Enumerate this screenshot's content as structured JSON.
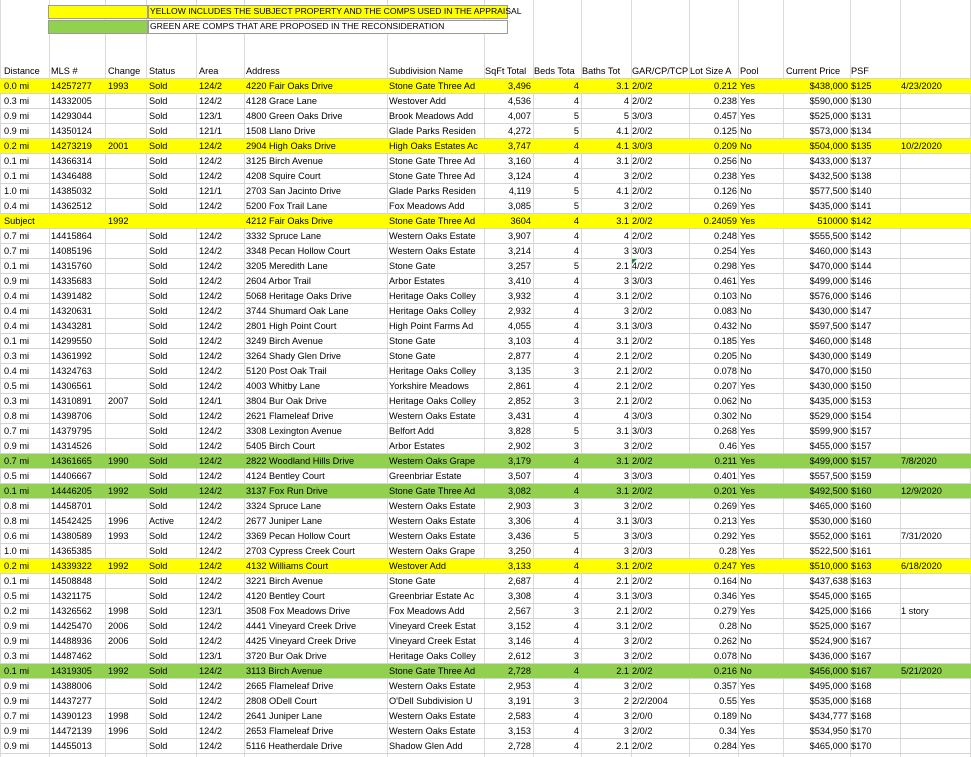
{
  "legend": {
    "yellow_text": "YELLOW INCLUDES THE SUBJECT PROPERTY AND THE COMPS USED IN THE APPRAISAL",
    "green_text": "GREEN ARE COMPS THAT ARE PROPOSED IN THE RECONSIDERATION",
    "yellow_color": "#ffff00",
    "green_color": "#92d050"
  },
  "headers": [
    "Distance",
    "MLS #",
    "Change",
    "Status",
    "Area",
    "Address",
    "Subdivision Name",
    "SqFt Total",
    "Beds Tota",
    "Baths Tot",
    "GAR/CP/TCP",
    "Lot Size A",
    "Pool",
    "Current Price",
    "PSF",
    ""
  ],
  "rows": [
    {
      "hl": "yellow",
      "c": [
        "0.0 mi",
        "14257277",
        "1993",
        "Sold",
        "124/2",
        "4220 Fair Oaks Drive",
        "Stone Gate Three Ad",
        "3,496",
        "4",
        "3.1",
        "2/0/2",
        "0.212",
        "Yes",
        "$438,000",
        "$125",
        "4/23/2020"
      ]
    },
    {
      "hl": "",
      "c": [
        "0.3 mi",
        "14332005",
        "",
        "Sold",
        "124/2",
        "4128 Grace Lane",
        "Westover Add",
        "4,536",
        "4",
        "4",
        "2/0/2",
        "0.238",
        "Yes",
        "$590,000",
        "$130",
        ""
      ]
    },
    {
      "hl": "",
      "c": [
        "0.9 mi",
        "14293044",
        "",
        "Sold",
        "123/1",
        "4800 Green Oaks Drive",
        "Brook Meadows Add",
        "4,007",
        "5",
        "5",
        "3/0/3",
        "0.457",
        "Yes",
        "$525,000",
        "$131",
        ""
      ]
    },
    {
      "hl": "",
      "c": [
        "0.9 mi",
        "14350124",
        "",
        "Sold",
        "121/1",
        "1508 Llano Drive",
        "Glade Parks Residen",
        "4,272",
        "5",
        "4.1",
        "2/0/2",
        "0.125",
        "No",
        "$573,000",
        "$134",
        ""
      ]
    },
    {
      "hl": "yellow",
      "c": [
        "0.2 mi",
        "14273219",
        "2001",
        "Sold",
        "124/2",
        "2904 High Oaks Drive",
        "High Oaks Estates Ac",
        "3,747",
        "4",
        "4.1",
        "3/0/3",
        "0.209",
        "No",
        "$504,000",
        "$135",
        "10/2/2020"
      ]
    },
    {
      "hl": "",
      "c": [
        "0.1 mi",
        "14366314",
        "",
        "Sold",
        "124/2",
        "3125 Birch Avenue",
        "Stone Gate Three Ad",
        "3,160",
        "4",
        "3.1",
        "2/0/2",
        "0.256",
        "No",
        "$433,000",
        "$137",
        ""
      ]
    },
    {
      "hl": "",
      "c": [
        "0.1 mi",
        "14346488",
        "",
        "Sold",
        "124/2",
        "4208 Squire Court",
        "Stone Gate Three Ad",
        "3,124",
        "4",
        "3",
        "2/0/2",
        "0.238",
        "Yes",
        "$432,500",
        "$138",
        ""
      ]
    },
    {
      "hl": "",
      "c": [
        "1.0 mi",
        "14385032",
        "",
        "Sold",
        "121/1",
        "2703 San Jacinto Drive",
        "Glade Parks Residen",
        "4,119",
        "5",
        "4.1",
        "2/0/2",
        "0.126",
        "No",
        "$577,500",
        "$140",
        ""
      ]
    },
    {
      "hl": "",
      "c": [
        "0.4 mi",
        "14362512",
        "",
        "Sold",
        "124/2",
        "5200 Fox Trail Lane",
        "Fox Meadows Add",
        "3,085",
        "5",
        "3",
        "2/0/2",
        "0.269",
        "Yes",
        "$435,000",
        "$141",
        ""
      ]
    },
    {
      "hl": "yellow",
      "c": [
        "Subject",
        "",
        "1992",
        "",
        "",
        "4212 Fair Oaks Drive",
        "Stone Gate Three Ad",
        "3604",
        "4",
        "3.1",
        "2/0/2",
        "0.24059",
        "Yes",
        "510000",
        "$142",
        ""
      ]
    },
    {
      "hl": "",
      "c": [
        "0.7 mi",
        "14415864",
        "",
        "Sold",
        "124/2",
        "3332 Spruce Lane",
        "Western Oaks Estate",
        "3,907",
        "4",
        "4",
        "2/0/2",
        "0.248",
        "Yes",
        "$555,500",
        "$142",
        ""
      ]
    },
    {
      "hl": "",
      "c": [
        "0.7 mi",
        "14085196",
        "",
        "Sold",
        "124/2",
        "3348 Pecan Hollow Court",
        "Western Oaks Estate",
        "3,214",
        "4",
        "3",
        "3/0/3",
        "0.254",
        "Yes",
        "$460,000",
        "$143",
        ""
      ]
    },
    {
      "hl": "",
      "c": [
        "0.1 mi",
        "14315760",
        "",
        "Sold",
        "124/2",
        "3205 Meredith Lane",
        "Stone Gate",
        "3,257",
        "5",
        "2.1",
        "4/2/2",
        "0.298",
        "Yes",
        "$470,000",
        "$144",
        ""
      ]
    },
    {
      "hl": "",
      "c": [
        "0.9 mi",
        "14335683",
        "",
        "Sold",
        "124/2",
        "2604 Arbor Trail",
        "Arbor Estates",
        "3,410",
        "4",
        "3",
        "3/0/3",
        "0.461",
        "Yes",
        "$499,000",
        "$146",
        ""
      ]
    },
    {
      "hl": "",
      "c": [
        "0.4 mi",
        "14391482",
        "",
        "Sold",
        "124/2",
        "5068 Heritage Oaks Drive",
        "Heritage Oaks Colley",
        "3,932",
        "4",
        "3.1",
        "2/0/2",
        "0.103",
        "No",
        "$576,000",
        "$146",
        ""
      ]
    },
    {
      "hl": "",
      "c": [
        "0.4 mi",
        "14320631",
        "",
        "Sold",
        "124/2",
        "3744 Shumard Oak Lane",
        "Heritage Oaks Colley",
        "2,932",
        "4",
        "3",
        "2/0/2",
        "0.083",
        "No",
        "$430,000",
        "$147",
        ""
      ]
    },
    {
      "hl": "",
      "c": [
        "0.4 mi",
        "14343281",
        "",
        "Sold",
        "124/2",
        "2801 High Point Court",
        "High Point Farms Ad",
        "4,055",
        "4",
        "3.1",
        "3/0/3",
        "0.432",
        "No",
        "$597,500",
        "$147",
        ""
      ]
    },
    {
      "hl": "",
      "c": [
        "0.1 mi",
        "14299550",
        "",
        "Sold",
        "124/2",
        "3249 Birch Avenue",
        "Stone Gate",
        "3,103",
        "4",
        "3.1",
        "2/0/2",
        "0.185",
        "Yes",
        "$460,000",
        "$148",
        ""
      ]
    },
    {
      "hl": "",
      "c": [
        "0.3 mi",
        "14361992",
        "",
        "Sold",
        "124/2",
        "3264 Shady Glen Drive",
        "Stone Gate",
        "2,877",
        "4",
        "2.1",
        "2/0/2",
        "0.205",
        "No",
        "$430,000",
        "$149",
        ""
      ]
    },
    {
      "hl": "",
      "c": [
        "0.4 mi",
        "14324763",
        "",
        "Sold",
        "124/2",
        "5120 Post Oak Trail",
        "Heritage Oaks Colley",
        "3,135",
        "3",
        "2.1",
        "2/0/2",
        "0.078",
        "No",
        "$470,000",
        "$150",
        ""
      ]
    },
    {
      "hl": "",
      "c": [
        "0.5 mi",
        "14306561",
        "",
        "Sold",
        "124/2",
        "4003 Whitby Lane",
        "Yorkshire Meadows",
        "2,861",
        "4",
        "2.1",
        "2/0/2",
        "0.207",
        "Yes",
        "$430,000",
        "$150",
        ""
      ]
    },
    {
      "hl": "",
      "c": [
        "0.3 mi",
        "14310891",
        "2007",
        "Sold",
        "124/1",
        "3804 Bur Oak Drive",
        "Heritage Oaks Colley",
        "2,852",
        "3",
        "2.1",
        "2/0/2",
        "0.062",
        "No",
        "$435,000",
        "$153",
        ""
      ]
    },
    {
      "hl": "",
      "c": [
        "0.8 mi",
        "14398706",
        "",
        "Sold",
        "124/2",
        "2621 Flameleaf Drive",
        "Western Oaks Estate",
        "3,431",
        "4",
        "4",
        "3/0/3",
        "0.302",
        "No",
        "$529,000",
        "$154",
        ""
      ]
    },
    {
      "hl": "",
      "c": [
        "0.7 mi",
        "14379795",
        "",
        "Sold",
        "124/2",
        "3308 Lexington Avenue",
        "Belfort Add",
        "3,828",
        "5",
        "3.1",
        "3/0/3",
        "0.268",
        "Yes",
        "$599,900",
        "$157",
        ""
      ]
    },
    {
      "hl": "",
      "c": [
        "0.9 mi",
        "14314526",
        "",
        "Sold",
        "124/2",
        "5405 Birch Court",
        "Arbor Estates",
        "2,902",
        "3",
        "3",
        "2/0/2",
        "0.46",
        "Yes",
        "$455,000",
        "$157",
        ""
      ]
    },
    {
      "hl": "green",
      "c": [
        "0.7 mi",
        "14361665",
        "1990",
        "Sold",
        "124/2",
        "2822 Woodland Hills Drive",
        "Western Oaks Grape",
        "3,179",
        "4",
        "3.1",
        "2/0/2",
        "0.211",
        "Yes",
        "$499,000",
        "$157",
        "7/8/2020"
      ]
    },
    {
      "hl": "",
      "c": [
        "0.5 mi",
        "14406667",
        "",
        "Sold",
        "124/2",
        "4124 Bentley Court",
        "Greenbriar Estate",
        "3,507",
        "4",
        "3",
        "3/0/3",
        "0.401",
        "Yes",
        "$557,500",
        "$159",
        ""
      ]
    },
    {
      "hl": "green",
      "c": [
        "0.1 mi",
        "14446205",
        "1992",
        "Sold",
        "124/2",
        "3137 Fox Run Drive",
        "Stone Gate Three Ad",
        "3,082",
        "4",
        "3.1",
        "2/0/2",
        "0.201",
        "Yes",
        "$492,500",
        "$160",
        "12/9/2020"
      ]
    },
    {
      "hl": "",
      "c": [
        "0.8 mi",
        "14458701",
        "",
        "Sold",
        "124/2",
        "3324 Spruce Lane",
        "Western Oaks Estate",
        "2,903",
        "3",
        "3",
        "2/0/2",
        "0.269",
        "Yes",
        "$465,000",
        "$160",
        ""
      ]
    },
    {
      "hl": "",
      "c": [
        "0.8 mi",
        "14542425",
        "1996",
        "Active",
        "124/2",
        "2677 Juniper Lane",
        "Western Oaks Estate",
        "3,306",
        "4",
        "3.1",
        "3/0/3",
        "0.213",
        "Yes",
        "$530,000",
        "$160",
        ""
      ]
    },
    {
      "hl": "",
      "c": [
        "0.6 mi",
        "14380589",
        "1993",
        "Sold",
        "124/2",
        "3369 Pecan Hollow Court",
        "Western Oaks Estate",
        "3,436",
        "5",
        "3",
        "3/0/3",
        "0.292",
        "Yes",
        "$552,000",
        "$161",
        "7/31/2020"
      ]
    },
    {
      "hl": "",
      "c": [
        "1.0 mi",
        "14365385",
        "",
        "Sold",
        "124/2",
        "2703 Cypress Creek Court",
        "Western Oaks Grape",
        "3,250",
        "4",
        "3",
        "2/0/3",
        "0.28",
        "Yes",
        "$522,500",
        "$161",
        ""
      ]
    },
    {
      "hl": "yellow",
      "c": [
        "0.2 mi",
        "14339322",
        "1992",
        "Sold",
        "124/2",
        "4132 Williams Court",
        "Westover Add",
        "3,133",
        "4",
        "3.1",
        "2/0/2",
        "0.247",
        "Yes",
        "$510,000",
        "$163",
        "6/18/2020"
      ]
    },
    {
      "hl": "",
      "c": [
        "0.1 mi",
        "14508848",
        "",
        "Sold",
        "124/2",
        "3221 Birch Avenue",
        "Stone Gate",
        "2,687",
        "4",
        "2.1",
        "2/0/2",
        "0.164",
        "No",
        "$437,638",
        "$163",
        ""
      ]
    },
    {
      "hl": "",
      "c": [
        "0.5 mi",
        "14321175",
        "",
        "Sold",
        "124/2",
        "4120 Bentley Court",
        "Greenbriar Estate Ac",
        "3,308",
        "4",
        "3.1",
        "3/0/3",
        "0.346",
        "Yes",
        "$545,000",
        "$165",
        ""
      ]
    },
    {
      "hl": "",
      "c": [
        "0.2 mi",
        "14326562",
        "1998",
        "Sold",
        "123/1",
        "3508 Fox Meadows Drive",
        "Fox Meadows Add",
        "2,567",
        "3",
        "2.1",
        "2/0/2",
        "0.279",
        "Yes",
        "$425,000",
        "$166",
        "1 story"
      ]
    },
    {
      "hl": "",
      "c": [
        "0.9 mi",
        "14425470",
        "2006",
        "Sold",
        "124/2",
        "4441 Vineyard Creek Drive",
        "Vineyard Creek Estat",
        "3,152",
        "4",
        "3.1",
        "2/0/2",
        "0.28",
        "No",
        "$525,000",
        "$167",
        ""
      ]
    },
    {
      "hl": "",
      "c": [
        "0.9 mi",
        "14488936",
        "2006",
        "Sold",
        "124/2",
        "4425 Vineyard Creek Drive",
        "Vineyard Creek Estat",
        "3,146",
        "4",
        "3",
        "2/0/2",
        "0.262",
        "No",
        "$524,900",
        "$167",
        ""
      ]
    },
    {
      "hl": "",
      "c": [
        "0.3 mi",
        "14487462",
        "",
        "Sold",
        "123/1",
        "3720 Bur Oak Drive",
        "Heritage Oaks Colley",
        "2,612",
        "3",
        "3",
        "2/0/2",
        "0.078",
        "No",
        "$436,000",
        "$167",
        ""
      ]
    },
    {
      "hl": "green",
      "c": [
        "0.1 mi",
        "14319305",
        "1992",
        "Sold",
        "124/2",
        "3113 Birch Avenue",
        "Stone Gate Three Ad",
        "2,728",
        "4",
        "2.1",
        "2/0/2",
        "0.216",
        "No",
        "$456,000",
        "$167",
        "5/21/2020"
      ]
    },
    {
      "hl": "",
      "c": [
        "0.9 mi",
        "14388006",
        "",
        "Sold",
        "124/2",
        "2665 Flameleaf Drive",
        "Western Oaks Estate",
        "2,953",
        "4",
        "3",
        "2/0/2",
        "0.357",
        "Yes",
        "$495,000",
        "$168",
        ""
      ]
    },
    {
      "hl": "",
      "c": [
        "0.9 mi",
        "14437277",
        "",
        "Sold",
        "124/2",
        "2808 ODell Court",
        "O'Dell Subdivision U",
        "3,191",
        "3",
        "2",
        "2/2/2004",
        "0.55",
        "Yes",
        "$535,000",
        "$168",
        ""
      ]
    },
    {
      "hl": "",
      "c": [
        "0.7 mi",
        "14390123",
        "1998",
        "Sold",
        "124/2",
        "2641 Juniper Lane",
        "Western Oaks Estate",
        "2,583",
        "4",
        "3",
        "2/0/0",
        "0.189",
        "No",
        "$434,777",
        "$168",
        ""
      ]
    },
    {
      "hl": "",
      "c": [
        "0.9 mi",
        "14472139",
        "1996",
        "Sold",
        "124/2",
        "2653 Flameleaf Drive",
        "Western Oaks Estate",
        "3,153",
        "4",
        "3",
        "2/0/2",
        "0.34",
        "Yes",
        "$534,950",
        "$170",
        ""
      ]
    },
    {
      "hl": "",
      "c": [
        "0.9 mi",
        "14455013",
        "",
        "Sold",
        "124/2",
        "5116 Heatherdale Drive",
        "Shadow Glen Add",
        "2,728",
        "4",
        "2.1",
        "2/0/2",
        "0.284",
        "Yes",
        "$465,000",
        "$170",
        ""
      ]
    }
  ]
}
